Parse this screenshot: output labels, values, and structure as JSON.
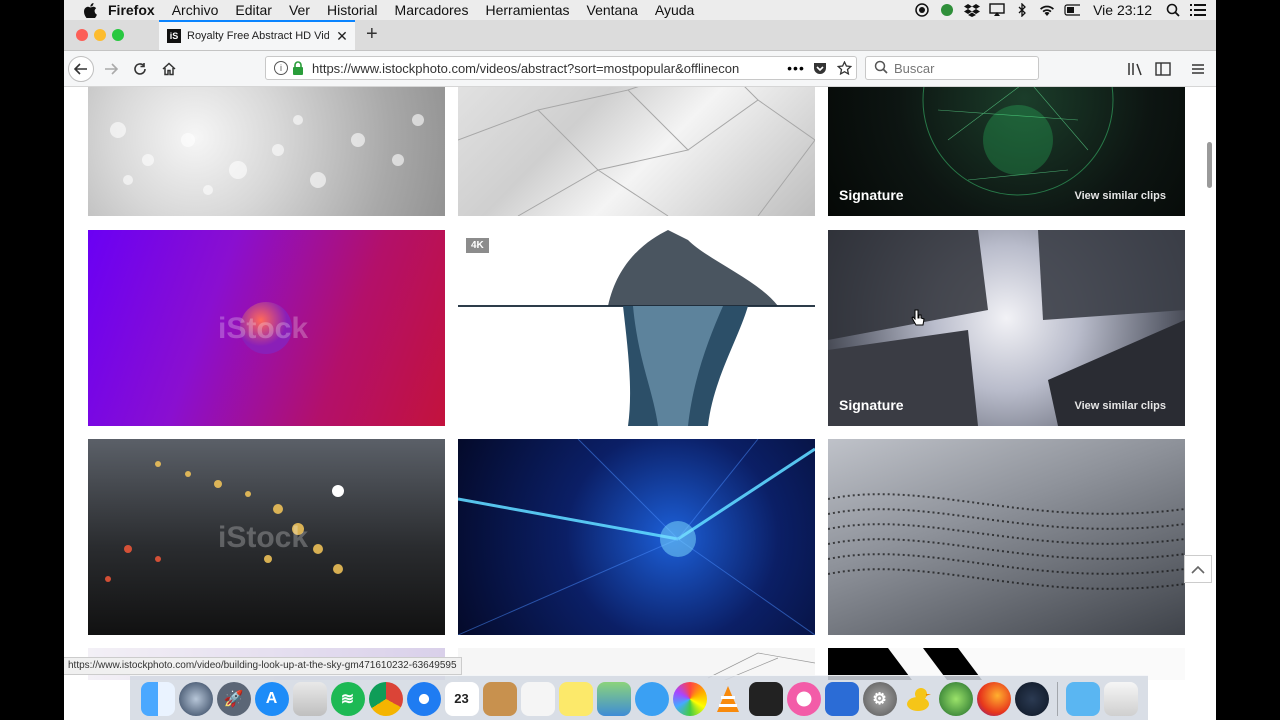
{
  "menubar": {
    "items": [
      "Firefox",
      "Archivo",
      "Editar",
      "Ver",
      "Historial",
      "Marcadores",
      "Herramientas",
      "Ventana",
      "Ayuda"
    ],
    "clock": "Vie 23:12"
  },
  "tab": {
    "title": "Royalty Free Abstract HD Video",
    "favicon": "iS"
  },
  "nav": {
    "url": "https://www.istockphoto.com/videos/abstract?sort=mostpopular&offlinecon",
    "search_placeholder": "Buscar"
  },
  "tiles": [
    {
      "id": "bokeh-silver"
    },
    {
      "id": "white-polygons"
    },
    {
      "id": "green-globe",
      "signature": "Signature",
      "similar": "View similar clips"
    },
    {
      "id": "purple-sphere",
      "watermark": "iStock"
    },
    {
      "id": "water-splash",
      "badge": "4K"
    },
    {
      "id": "buildings-sky",
      "signature": "Signature",
      "similar": "View similar clips"
    },
    {
      "id": "city-lights",
      "watermark": "iStock"
    },
    {
      "id": "blue-tunnel"
    },
    {
      "id": "dot-wave"
    }
  ],
  "status_url": "https://www.istockphoto.com/video/building-look-up-at-the-sky-gm471610232-63649595",
  "dock": {
    "calendar_day": "23"
  },
  "colors": {
    "accent": "#0a84ff",
    "lock_green": "#2a9d3a",
    "menubar_bg": "#ececec"
  }
}
